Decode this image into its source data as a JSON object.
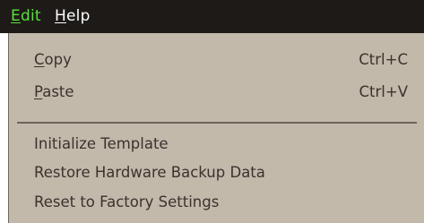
{
  "menubar": {
    "items": [
      {
        "label_mnemonic": "E",
        "label_rest": "dit",
        "color": "#58e03a",
        "active": true
      },
      {
        "label_mnemonic": "H",
        "label_rest": "elp",
        "color": "#ffffff",
        "active": false
      }
    ]
  },
  "edit_menu": {
    "items": [
      {
        "mnemonic": "C",
        "rest": "opy",
        "shortcut": "Ctrl+C"
      },
      {
        "mnemonic": "P",
        "rest": "aste",
        "shortcut": "Ctrl+V"
      },
      {
        "label": "Initialize Template"
      },
      {
        "label": "Restore Hardware Backup Data"
      },
      {
        "label": "Reset to Factory Settings"
      }
    ]
  },
  "colors": {
    "menubar_bg": "#1e1a18",
    "menu_bg": "#c2b9ab",
    "text": "#3a332d",
    "active_menu": "#58e03a"
  }
}
